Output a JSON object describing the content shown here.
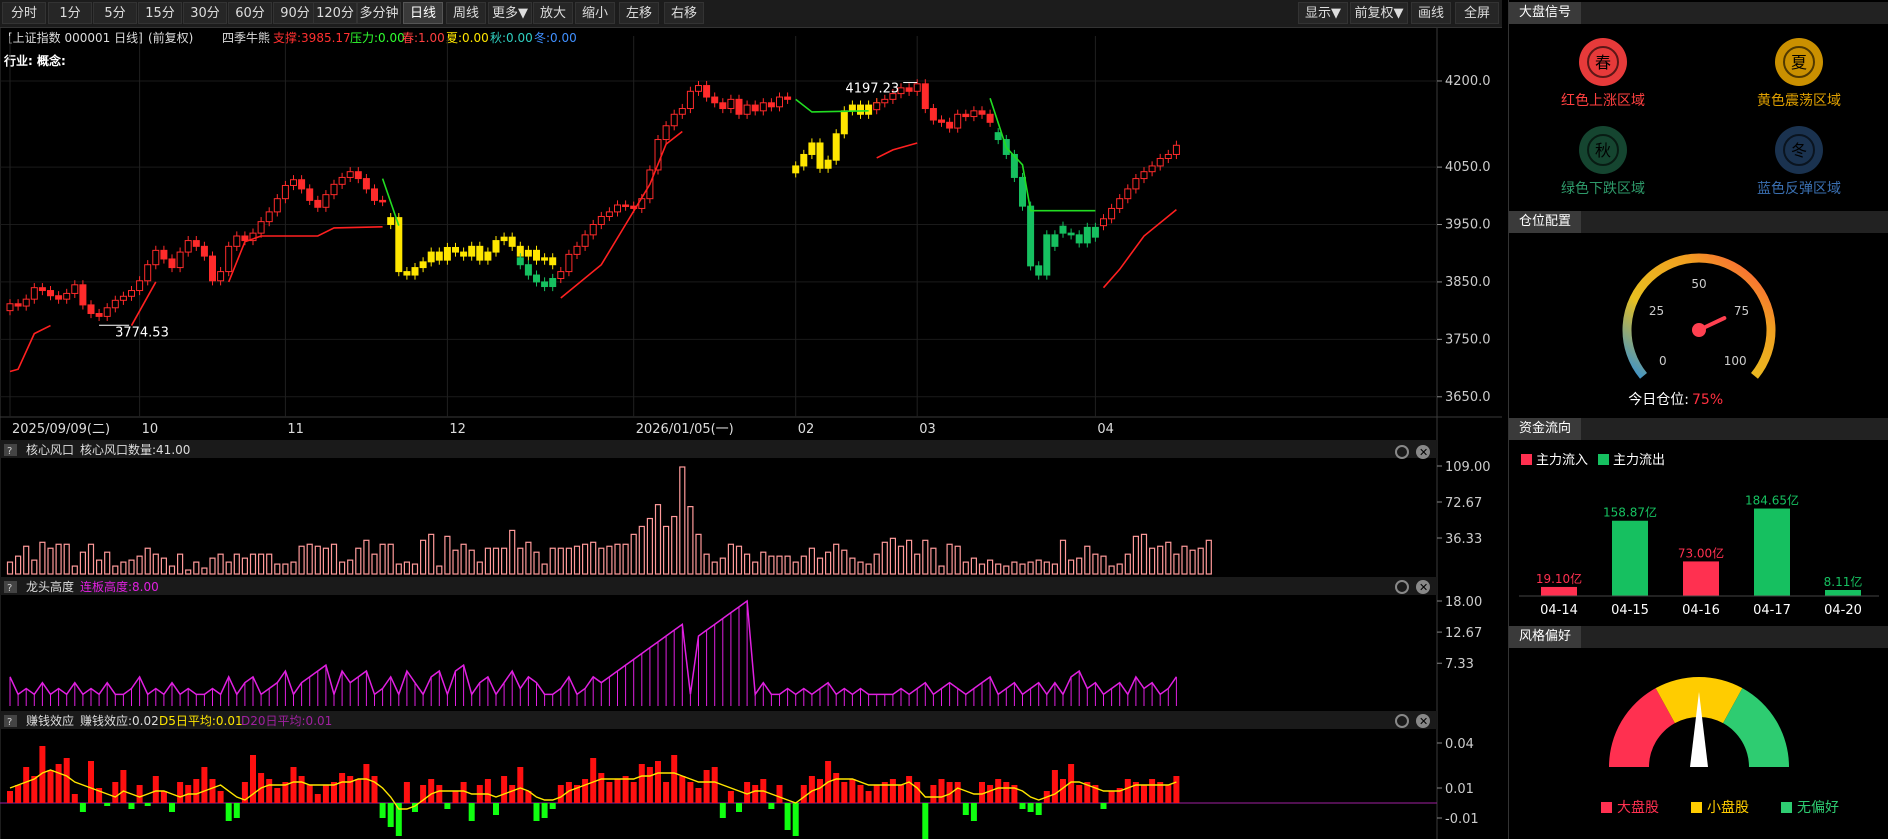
{
  "toolbar": {
    "buttons": [
      {
        "label": "分时",
        "x": 2,
        "w": 44
      },
      {
        "label": "1分",
        "x": 48,
        "w": 44
      },
      {
        "label": "5分",
        "x": 93,
        "w": 44
      },
      {
        "label": "15分",
        "x": 138,
        "w": 44
      },
      {
        "label": "30分",
        "x": 183,
        "w": 44
      },
      {
        "label": "60分",
        "x": 228,
        "w": 44
      },
      {
        "label": "90分",
        "x": 273,
        "w": 44
      },
      {
        "label": "120分",
        "x": 313,
        "w": 44
      },
      {
        "label": "多分钟",
        "x": 357,
        "w": 44
      },
      {
        "label": "日线",
        "x": 403,
        "w": 40,
        "active": true
      },
      {
        "label": "周线",
        "x": 446,
        "w": 40
      },
      {
        "label": "更多▼",
        "x": 488,
        "w": 44
      },
      {
        "label": "放大",
        "x": 533,
        "w": 40
      },
      {
        "label": "缩小",
        "x": 575,
        "w": 40
      },
      {
        "label": "左移",
        "x": 619,
        "w": 40
      },
      {
        "label": "右移",
        "x": 664,
        "w": 40
      }
    ],
    "right_buttons": [
      {
        "label": "显示▼",
        "x": 1298,
        "w": 50
      },
      {
        "label": "前复权▼",
        "x": 1350,
        "w": 58
      },
      {
        "label": "画线",
        "x": 1411,
        "w": 40
      },
      {
        "label": "全屏",
        "x": 1455,
        "w": 44
      }
    ]
  },
  "info": {
    "symbol": "[上证指数 000001 日线]",
    "adjust": "(前复权)",
    "indicator": "四季牛熊",
    "support": "支撑:3985.17",
    "pressure": "压力:0.00",
    "spring": "春:1.00",
    "summer": "夏:0.00",
    "autumn": "秋:0.00",
    "winter": "冬:0.00",
    "industry": "行业: 概念:"
  },
  "panels": {
    "p1": {
      "name": "核心风口",
      "value": "核心风口数量:41.00"
    },
    "p2": {
      "name": "龙头高度",
      "value": "连板高度:8.00"
    },
    "p3": {
      "name": "赚钱效应",
      "value": "赚钱效应:0.02",
      "d5": "D5日平均:0.01",
      "d20": "D20日平均:0.01"
    }
  },
  "colors": {
    "up": "#ff2b2b",
    "down": "#16c060",
    "yellow": "#ffe600",
    "magenta": "#e020e0",
    "support": "#ff2020",
    "pressure": "#22dd22",
    "pink": "#ff9a9a"
  },
  "right": {
    "signal": {
      "title": "大盘信号",
      "items": [
        {
          "glyph": "春",
          "label": "红色上涨区域",
          "color": "#ff4040"
        },
        {
          "glyph": "夏",
          "label": "黄色震荡区域",
          "color": "#e0a000"
        },
        {
          "glyph": "秋",
          "label": "绿色下跌区域",
          "color": "#2e9a6a"
        },
        {
          "glyph": "冬",
          "label": "蓝色反弹区域",
          "color": "#3a6fb0"
        }
      ]
    },
    "position": {
      "title": "仓位配置",
      "ticks": [
        "0",
        "25",
        "50",
        "75",
        "100"
      ],
      "label": "今日仓位:",
      "value": "75%",
      "percent": 75
    },
    "flow": {
      "title": "资金流向",
      "legend_in": "主力流入",
      "legend_out": "主力流出"
    },
    "style": {
      "title": "风格偏好",
      "legend": [
        "大盘股",
        "小盘股",
        "无偏好"
      ]
    }
  },
  "chart_data": [
    {
      "type": "candlestick",
      "title": "上证指数 000001 日线",
      "ylim": [
        3620,
        4240
      ],
      "yticks": [
        "4200.0",
        "4050.0",
        "3950.0",
        "3850.0",
        "3750.0",
        "3650.0"
      ],
      "ytick_values": [
        4200,
        4050,
        3950,
        3850,
        3750,
        3650
      ],
      "xticks": [
        {
          "i": 0,
          "label": "2025/09/09(二)"
        },
        {
          "i": 16,
          "label": "10"
        },
        {
          "i": 34,
          "label": "11"
        },
        {
          "i": 54,
          "label": "12"
        },
        {
          "i": 77,
          "label": "2026/01/05(一)"
        },
        {
          "i": 97,
          "label": "02"
        },
        {
          "i": 112,
          "label": "03"
        },
        {
          "i": 134,
          "label": "04"
        }
      ],
      "annotations": [
        {
          "text": "4197.23",
          "i": 112,
          "value": 4197.23
        },
        {
          "text": "3774.53",
          "i": 11,
          "value": 3774.53
        }
      ],
      "segments": [
        {
          "start": 0,
          "end": 46,
          "color": "up",
          "closes": [
            3812,
            3808,
            3820,
            3840,
            3835,
            3826,
            3820,
            3830,
            3845,
            3810,
            3795,
            3790,
            3805,
            3818,
            3825,
            3835,
            3852,
            3880,
            3905,
            3890,
            3875,
            3902,
            3922,
            3912,
            3895,
            3852,
            3868,
            3912,
            3930,
            3922,
            3935,
            3955,
            3972,
            3995,
            4018,
            4028,
            4012,
            3992,
            3980,
            4002,
            4020,
            4032,
            4042,
            4030,
            4012,
            3992,
            3990
          ]
        },
        {
          "start": 47,
          "end": 67,
          "color": "yellow",
          "closes": [
            3962,
            3868,
            3862,
            3875,
            3885,
            3902,
            3888,
            3910,
            3902,
            3895,
            3912,
            3888,
            3902,
            3922,
            3928,
            3912,
            3895,
            3905,
            3888,
            3892,
            3880
          ]
        },
        {
          "start": 63,
          "end": 67,
          "color": "down",
          "closes": [
            3880,
            3862,
            3850,
            3842,
            3856
          ]
        },
        {
          "start": 68,
          "end": 96,
          "color": "up",
          "closes": [
            3868,
            3898,
            3912,
            3932,
            3950,
            3964,
            3972,
            3984,
            3982,
            3978,
            3995,
            4045,
            4098,
            4122,
            4142,
            4152,
            4182,
            4192,
            4172,
            4162,
            4152,
            4168,
            4142,
            4158,
            4148,
            4162,
            4155,
            4172,
            4168
          ]
        },
        {
          "start": 97,
          "end": 107,
          "color": "yellow",
          "closes": [
            4052,
            4072,
            4092,
            4048,
            4062,
            4108,
            4148,
            4158,
            4142,
            4158,
            4162
          ]
        },
        {
          "start": 107,
          "end": 121,
          "color": "up",
          "closes": [
            4162,
            4168,
            4178,
            4188,
            4182,
            4195,
            4152,
            4132,
            4128,
            4118,
            4142,
            4138,
            4148,
            4142,
            4128
          ]
        },
        {
          "start": 122,
          "end": 129,
          "color": "down",
          "closes": [
            4098,
            4072,
            4032,
            3982,
            3878,
            3862,
            3932,
            3912
          ]
        },
        {
          "start": 130,
          "end": 134,
          "color": "down",
          "closes": [
            3935,
            3932,
            3918,
            3945,
            3928
          ]
        },
        {
          "start": 135,
          "end": 144,
          "color": "up",
          "closes": [
            3960,
            3978,
            3995,
            4012,
            4030,
            4042,
            4052,
            4065,
            4072,
            4088
          ]
        }
      ],
      "support_line": [
        {
          "i": 0,
          "v": 3694
        },
        {
          "i": 1,
          "v": 3698
        },
        {
          "i": 3,
          "v": 3760
        },
        {
          "i": 5,
          "v": 3774
        },
        {
          "i": 15,
          "v": 3774
        },
        {
          "i": 18,
          "v": 3850
        },
        {
          "i": 27,
          "v": 3850
        },
        {
          "i": 29,
          "v": 3920
        },
        {
          "i": 31,
          "v": 3930
        },
        {
          "i": 38,
          "v": 3930
        },
        {
          "i": 40,
          "v": 3944
        },
        {
          "i": 46,
          "v": 3946
        },
        {
          "i": 68,
          "v": 3822
        },
        {
          "i": 73,
          "v": 3880
        },
        {
          "i": 76,
          "v": 3950
        },
        {
          "i": 79,
          "v": 4020
        },
        {
          "i": 81,
          "v": 4090
        },
        {
          "i": 83,
          "v": 4112
        },
        {
          "i": 96,
          "v": 4114
        },
        {
          "i": 107,
          "v": 4066
        },
        {
          "i": 109,
          "v": 4080
        },
        {
          "i": 112,
          "v": 4092
        },
        {
          "i": 121,
          "v": 4094
        },
        {
          "i": 135,
          "v": 3840
        },
        {
          "i": 137,
          "v": 3872
        },
        {
          "i": 140,
          "v": 3930
        },
        {
          "i": 144,
          "v": 3976
        }
      ],
      "pressure_line": [
        {
          "i": 46,
          "v": 4030
        },
        {
          "i": 48,
          "v": 3948
        },
        {
          "i": 66,
          "v": 3932
        },
        {
          "i": 97,
          "v": 4168
        },
        {
          "i": 99,
          "v": 4146
        },
        {
          "i": 106,
          "v": 4148
        },
        {
          "i": 121,
          "v": 4170
        },
        {
          "i": 123,
          "v": 4084
        },
        {
          "i": 125,
          "v": 4054
        },
        {
          "i": 126,
          "v": 3974
        },
        {
          "i": 134,
          "v": 3974
        }
      ]
    },
    {
      "type": "bar",
      "title": "核心风口",
      "ylim": [
        0,
        109
      ],
      "yticks": [
        "109.00",
        "72.67",
        "36.33"
      ],
      "ytick_values": [
        109.0,
        72.67,
        36.33
      ],
      "values": [
        12,
        18,
        28,
        14,
        32,
        26,
        30,
        30,
        8,
        22,
        30,
        14,
        22,
        8,
        12,
        14,
        18,
        26,
        20,
        16,
        8,
        20,
        4,
        12,
        6,
        16,
        20,
        12,
        20,
        16,
        20,
        20,
        20,
        10,
        10,
        12,
        28,
        30,
        28,
        26,
        30,
        12,
        14,
        26,
        34,
        20,
        30,
        30,
        10,
        12,
        10,
        34,
        40,
        8,
        38,
        24,
        30,
        24,
        12,
        26,
        26,
        26,
        44,
        26,
        32,
        22,
        10,
        26,
        26,
        26,
        28,
        30,
        32,
        26,
        28,
        30,
        30,
        40,
        48,
        56,
        70,
        48,
        58,
        108,
        68,
        40,
        20,
        12,
        16,
        30,
        28,
        20,
        12,
        22,
        18,
        18,
        18,
        12,
        18,
        26,
        16,
        22,
        30,
        24,
        16,
        12,
        10,
        20,
        32,
        36,
        28,
        34,
        20,
        34,
        26,
        8,
        30,
        28,
        12,
        16,
        10,
        14,
        10,
        8,
        12,
        10,
        12,
        14,
        12,
        10,
        34,
        14,
        16,
        28,
        20,
        18,
        8,
        10,
        20,
        38,
        40,
        26,
        28,
        32,
        20,
        28,
        24,
        26,
        34
      ]
    },
    {
      "type": "line",
      "title": "龙头高度",
      "ylim": [
        0,
        18
      ],
      "yticks": [
        "18.00",
        "12.67",
        "7.33"
      ],
      "ytick_values": [
        18.0,
        12.67,
        7.33
      ],
      "values": [
        5,
        2,
        3,
        2,
        4,
        2,
        3,
        2,
        4,
        2,
        3,
        2,
        4,
        2,
        2,
        3,
        5,
        2,
        3,
        2,
        4,
        2,
        3,
        2,
        2,
        3,
        2,
        5,
        2,
        4,
        5,
        2,
        3,
        4,
        6,
        2,
        4,
        5,
        6,
        7,
        2,
        6,
        4,
        5,
        6,
        2,
        3,
        5,
        2,
        6,
        4,
        2,
        5,
        6,
        2,
        6,
        7,
        2,
        4,
        5,
        2,
        4,
        6,
        3,
        5,
        4,
        2,
        2,
        3,
        5,
        2,
        3,
        5,
        4,
        5,
        6,
        7,
        8,
        9,
        10,
        11,
        12,
        13,
        14,
        2,
        12,
        13,
        14,
        15,
        16,
        17,
        18,
        2,
        4,
        2,
        2,
        3,
        2,
        3,
        2,
        3,
        4,
        2,
        3,
        2,
        3,
        2,
        2,
        2,
        2,
        3,
        2,
        3,
        4,
        2,
        3,
        4,
        3,
        2,
        3,
        4,
        5,
        2,
        3,
        4,
        2,
        3,
        4,
        2,
        4,
        2,
        5,
        6,
        3,
        4,
        2,
        3,
        4,
        2,
        5,
        3,
        4,
        2,
        3,
        5
      ]
    },
    {
      "type": "bar",
      "title": "赚钱效应",
      "ylim": [
        -0.022,
        0.046
      ],
      "yticks": [
        "0.04",
        "0.01",
        "-0.01"
      ],
      "ytick_values": [
        0.04,
        0.01,
        -0.01
      ],
      "values": [
        0.008,
        0.012,
        0.024,
        0.018,
        0.038,
        0.022,
        0.026,
        0.03,
        0.006,
        -0.006,
        0.028,
        0.01,
        -0.002,
        0.014,
        0.022,
        -0.004,
        0.012,
        -0.002,
        0.018,
        0.008,
        -0.006,
        0.014,
        0.012,
        0.016,
        0.024,
        0.016,
        0.008,
        -0.012,
        -0.01,
        0.014,
        0.032,
        0.02,
        0.016,
        0.01,
        0.014,
        0.024,
        0.018,
        0.012,
        0.006,
        0.012,
        0.014,
        0.02,
        0.018,
        0.016,
        0.026,
        0.018,
        -0.01,
        -0.016,
        -0.022,
        0.014,
        -0.006,
        0.012,
        0.016,
        0.012,
        -0.004,
        0.008,
        0.014,
        -0.012,
        0.012,
        0.016,
        -0.008,
        0.018,
        0.012,
        0.024,
        0.008,
        -0.012,
        -0.01,
        -0.004,
        0.012,
        0.014,
        0.012,
        0.016,
        0.03,
        0.02,
        0.014,
        0.016,
        0.018,
        0.014,
        0.026,
        0.024,
        0.028,
        0.014,
        0.032,
        0.018,
        0.014,
        0.01,
        0.022,
        0.024,
        -0.01,
        0.008,
        -0.006,
        0.014,
        0.012,
        0.016,
        -0.004,
        0.012,
        -0.018,
        -0.022,
        0.012,
        0.018,
        0.016,
        0.028,
        0.02,
        0.014,
        0.016,
        0.012,
        0.008,
        0.012,
        0.014,
        0.016,
        0.012,
        0.018,
        0.014,
        -0.038,
        0.012,
        0.016,
        0.014,
        0.014,
        -0.008,
        -0.012,
        0.014,
        0.012,
        0.016,
        0.014,
        0.012,
        -0.004,
        -0.006,
        -0.008,
        0.008,
        0.022,
        0.016,
        0.026,
        0.012,
        0.014,
        0.012,
        -0.004,
        0.008,
        0.01,
        0.016,
        0.014,
        0.012,
        0.016,
        0.014,
        0.012,
        0.018
      ],
      "ma5": [
        0.01,
        0.012,
        0.014,
        0.016,
        0.02,
        0.022,
        0.02,
        0.018,
        0.014,
        0.012,
        0.01,
        0.008,
        0.006,
        0.004,
        0.008,
        0.006,
        0.004,
        0.006,
        0.008,
        0.008,
        0.006,
        0.004,
        0.006,
        0.006,
        0.008,
        0.01,
        0.012,
        0.008,
        0.004,
        0.002,
        0.006,
        0.01,
        0.012,
        0.012,
        0.012,
        0.014,
        0.014,
        0.012,
        0.012,
        0.012,
        0.012,
        0.014,
        0.014,
        0.016,
        0.016,
        0.014,
        0.01,
        0.004,
        -0.004,
        -0.004,
        -0.002,
        0.002,
        0.006,
        0.008,
        0.008,
        0.008,
        0.008,
        0.006,
        0.006,
        0.006,
        0.004,
        0.006,
        0.008,
        0.01,
        0.008,
        0.004,
        0.002,
        0.002,
        0.004,
        0.008,
        0.01,
        0.012,
        0.014,
        0.016,
        0.016,
        0.016,
        0.016,
        0.016,
        0.018,
        0.018,
        0.02,
        0.02,
        0.02,
        0.018,
        0.016,
        0.014,
        0.014,
        0.014,
        0.012,
        0.01,
        0.008,
        0.006,
        0.008,
        0.008,
        0.006,
        0.004,
        0.002,
        0,
        0.004,
        0.008,
        0.01,
        0.014,
        0.016,
        0.016,
        0.016,
        0.014,
        0.012,
        0.012,
        0.012,
        0.012,
        0.012,
        0.014,
        0.01,
        0.004,
        0.004,
        0.004,
        0.006,
        0.01,
        0.008,
        0.006,
        0.006,
        0.008,
        0.01,
        0.01,
        0.01,
        0.008,
        0.004,
        0.002,
        0.004,
        0.006,
        0.01,
        0.014,
        0.014,
        0.012,
        0.01,
        0.008,
        0.008,
        0.008,
        0.01,
        0.012,
        0.012,
        0.012,
        0.012,
        0.012,
        0.014
      ]
    },
    {
      "type": "bar",
      "title": "资金流向",
      "categories": [
        "04-14",
        "04-15",
        "04-16",
        "04-17",
        "04-20"
      ],
      "values": [
        19.1,
        158.87,
        73.0,
        184.65,
        8.11
      ],
      "labels": [
        "19.10亿",
        "158.87亿",
        "73.00亿",
        "184.65亿",
        "8.11亿"
      ],
      "direction": [
        "in",
        "out",
        "in",
        "out",
        "out"
      ]
    }
  ]
}
